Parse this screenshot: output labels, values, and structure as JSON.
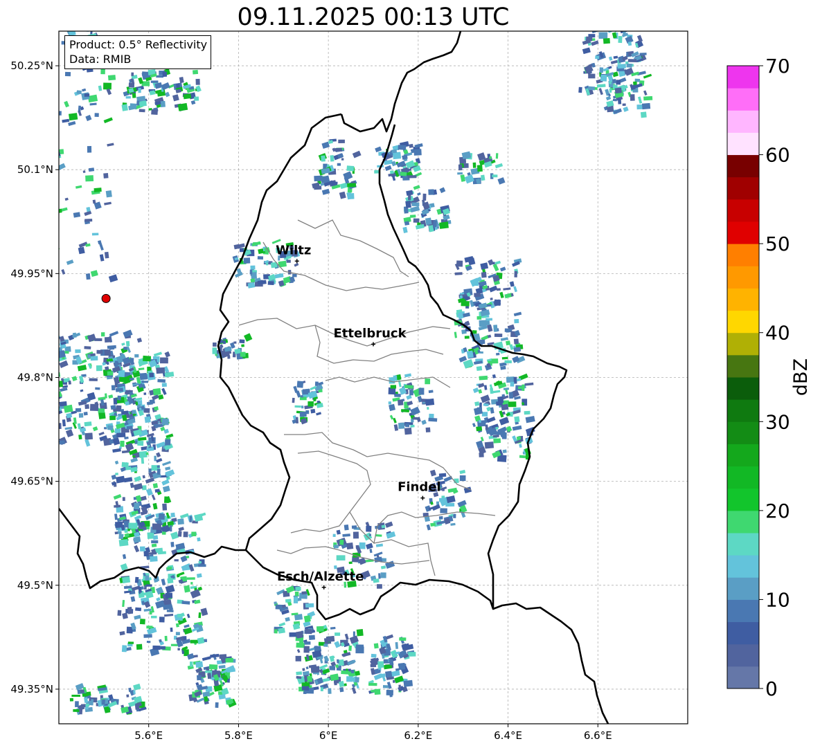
{
  "title": "09.11.2025 00:13 UTC",
  "info": {
    "product": "Product: 0.5° Reflectivity",
    "data": "Data: RMIB"
  },
  "map": {
    "lon_range": [
      5.4,
      6.8
    ],
    "lat_range": [
      49.3,
      50.3
    ],
    "lon_ticks": [
      {
        "value": 5.6,
        "label": "5.6°E"
      },
      {
        "value": 5.8,
        "label": "5.8°E"
      },
      {
        "value": 6.0,
        "label": "6°E"
      },
      {
        "value": 6.2,
        "label": "6.2°E"
      },
      {
        "value": 6.4,
        "label": "6.4°E"
      },
      {
        "value": 6.6,
        "label": "6.6°E"
      }
    ],
    "lat_ticks": [
      {
        "value": 50.25,
        "label": "50.25°N"
      },
      {
        "value": 50.1,
        "label": "50.1°N"
      },
      {
        "value": 49.95,
        "label": "49.95°N"
      },
      {
        "value": 49.8,
        "label": "49.8°N"
      },
      {
        "value": 49.65,
        "label": "49.65°N"
      },
      {
        "value": 49.5,
        "label": "49.5°N"
      },
      {
        "value": 49.35,
        "label": "49.35°N"
      }
    ],
    "grid": true,
    "cities": [
      {
        "name": "Wiltz",
        "lon": 5.93,
        "lat": 49.968
      },
      {
        "name": "Ettelbruck",
        "lon": 6.1,
        "lat": 49.848
      },
      {
        "name": "Findel",
        "lon": 6.21,
        "lat": 49.626
      },
      {
        "name": "Esch/Alzette",
        "lon": 5.99,
        "lat": 49.497
      }
    ],
    "radar_site": {
      "lon": 5.505,
      "lat": 49.914,
      "color": "#e00000"
    }
  },
  "colorbar": {
    "label": "dBZ",
    "range": [
      0,
      70
    ],
    "tick_values": [
      0,
      10,
      20,
      30,
      40,
      50,
      60,
      70
    ],
    "tick_labels": [
      "0",
      "10",
      "20",
      "30",
      "40",
      "50",
      "60",
      "70"
    ],
    "colors": [
      "#6577a8",
      "#51649e",
      "#3f5da2",
      "#4a78b2",
      "#5a9ec5",
      "#63c3db",
      "#5dd8c4",
      "#3fd870",
      "#12c52c",
      "#12b825",
      "#14a81c",
      "#138c15",
      "#0f7a10",
      "#0b5d0b",
      "#477611",
      "#b0b005",
      "#ffd700",
      "#ffb300",
      "#ff9900",
      "#ff7f00",
      "#e00000",
      "#c80000",
      "#a00000",
      "#780000",
      "#ffe2ff",
      "#ffb6ff",
      "#ff6ef8",
      "#ee35ee"
    ]
  }
}
